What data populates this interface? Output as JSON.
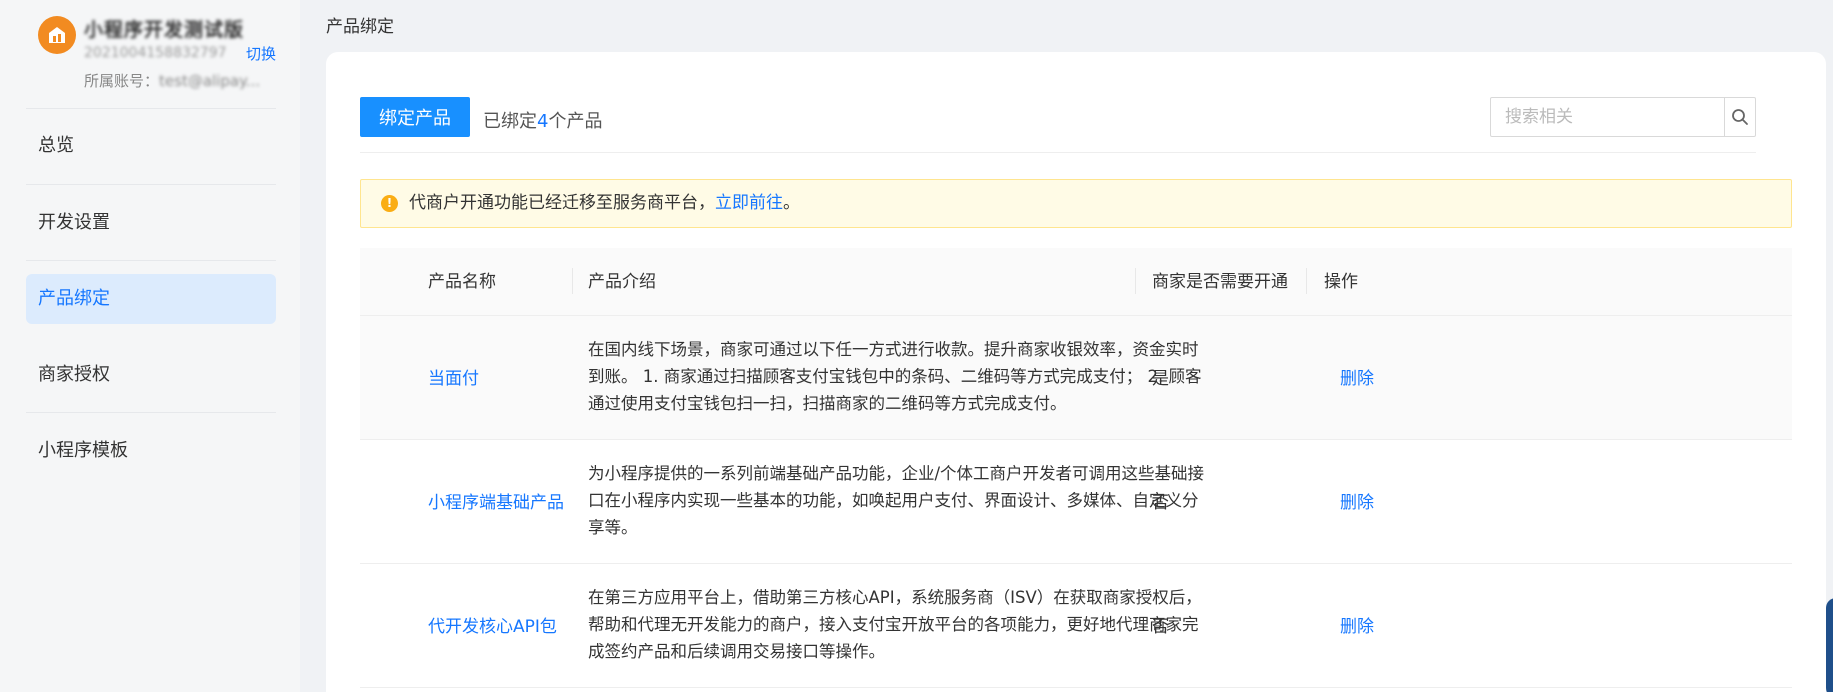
{
  "sidebar": {
    "app_name": "小程序开发测试版",
    "app_id": "2021004158832797",
    "switch_label": "切换",
    "account_label": "所属账号：",
    "account_value": "test@alipay...",
    "nav": [
      {
        "label": "总览"
      },
      {
        "label": "开发设置"
      },
      {
        "label": "产品绑定"
      },
      {
        "label": "商家授权"
      },
      {
        "label": "小程序模板"
      }
    ]
  },
  "header": {
    "title": "产品绑定"
  },
  "toolbar": {
    "bind_label": "绑定产品",
    "bound_prefix": "已绑定",
    "bound_count": "4",
    "bound_suffix": "个产品",
    "search_placeholder": "搜索相关"
  },
  "notice": {
    "text": "代商户开通功能已经迁移至服务商平台，",
    "link": "立即前往",
    "end": "。"
  },
  "table": {
    "headers": [
      "产品名称",
      "产品介绍",
      "商家是否需要开通",
      "操作"
    ],
    "rows": [
      {
        "name": "当面付",
        "desc": "在国内线下场景，商家可通过以下任一方式进行收款。提升商家收银效率，资金实时到账。 1. 商家通过扫描顾客支付宝钱包中的条码、二维码等方式完成支付； 2. 顾客通过使用支付宝钱包扫一扫，扫描商家的二维码等方式完成支付。",
        "need": "是",
        "action": "删除"
      },
      {
        "name": "小程序端基础产品",
        "desc": "为小程序提供的一系列前端基础产品功能，企业/个体工商户开发者可调用这些基础接口在小程序内实现一些基本的功能，如唤起用户支付、界面设计、多媒体、自定义分享等。",
        "need": "否",
        "action": "删除"
      },
      {
        "name": "代开发核心API包",
        "desc": "在第三方应用平台上，借助第三方核心API，系统服务商（ISV）在获取商家授权后，帮助和代理无开发能力的商户，接入支付宝开放平台的各项能力，更好地代理商家完成签约产品和后续调用交易接口等操作。",
        "need": "否",
        "action": "删除"
      }
    ]
  },
  "colors": {
    "accent": "#1677ff",
    "primary_button": "#1890ff",
    "notice_bg": "#fffbe6",
    "notice_icon": "#faad14",
    "logo": "#f28b21"
  }
}
